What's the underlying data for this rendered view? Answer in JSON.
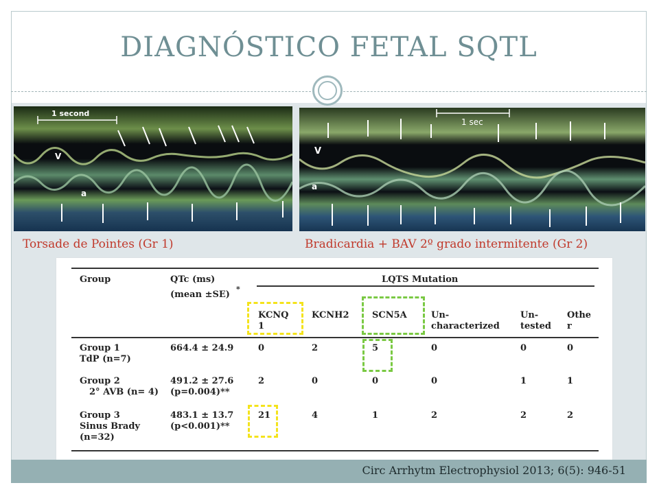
{
  "slide": {
    "title": "DIAGNÓSTICO FETAL SQTL",
    "left_image": {
      "scale_label": "1 second",
      "v_label": "V",
      "a_label": "a",
      "caption": "Torsade de Pointes (Gr 1)"
    },
    "right_image": {
      "scale_label": "1 sec",
      "v_label": "V",
      "a_label": "a",
      "caption": "Bradicardia + BAV 2º grado intermitente (Gr 2)"
    },
    "citation": "Circ Arrhytm Electrophysiol 2013; 6(5): 946-51"
  },
  "table": {
    "col_group": "Group",
    "col_qtc": "QTc (ms)",
    "col_qtc_sub": "(mean ±SE)",
    "col_qtc_star": "*",
    "lqts_header": "LQTS Mutation",
    "mutations": {
      "kcnq_1": "KCNQ",
      "kcnq_2": "1",
      "kcnh2": "KCNH2",
      "scn5a": "SCN5A",
      "unchar_1": "Un-",
      "unchar_2": "characterized",
      "untested_1": "Un-",
      "untested_2": "tested",
      "other_1": "Othe",
      "other_2": "r"
    },
    "rows": [
      {
        "group_1": "Group 1",
        "group_2": "TdP (n=7)",
        "group_3": "",
        "qtc_1": "664.4 ± 24.9",
        "qtc_2": "",
        "kcnq1": "0",
        "kcnh2": "2",
        "scn5a": "5",
        "unchar": "0",
        "untested": "0",
        "other": "0"
      },
      {
        "group_1": "Group 2",
        "group_2": "2° AVB (n= 4)",
        "group_3": "",
        "qtc_1": "491.2 ± 27.6",
        "qtc_2": "(p=0.004)**",
        "kcnq1": "2",
        "kcnh2": "0",
        "scn5a": "0",
        "unchar": "0",
        "untested": "1",
        "other": "1"
      },
      {
        "group_1": "Group 3",
        "group_2": "Sinus Brady",
        "group_3": "(n=32)",
        "qtc_1": "483.1 ± 13.7",
        "qtc_2": "(p<0.001)**",
        "kcnq1": "21",
        "kcnh2": "4",
        "scn5a": "1",
        "unchar": "2",
        "untested": "2",
        "other": "2"
      }
    ]
  },
  "colors": {
    "title": "#6f8f94",
    "caption": "#c0392b",
    "footer_bar": "#95b0b3",
    "highlight_yellow": "#f4e31c",
    "highlight_green": "#7ac943"
  }
}
